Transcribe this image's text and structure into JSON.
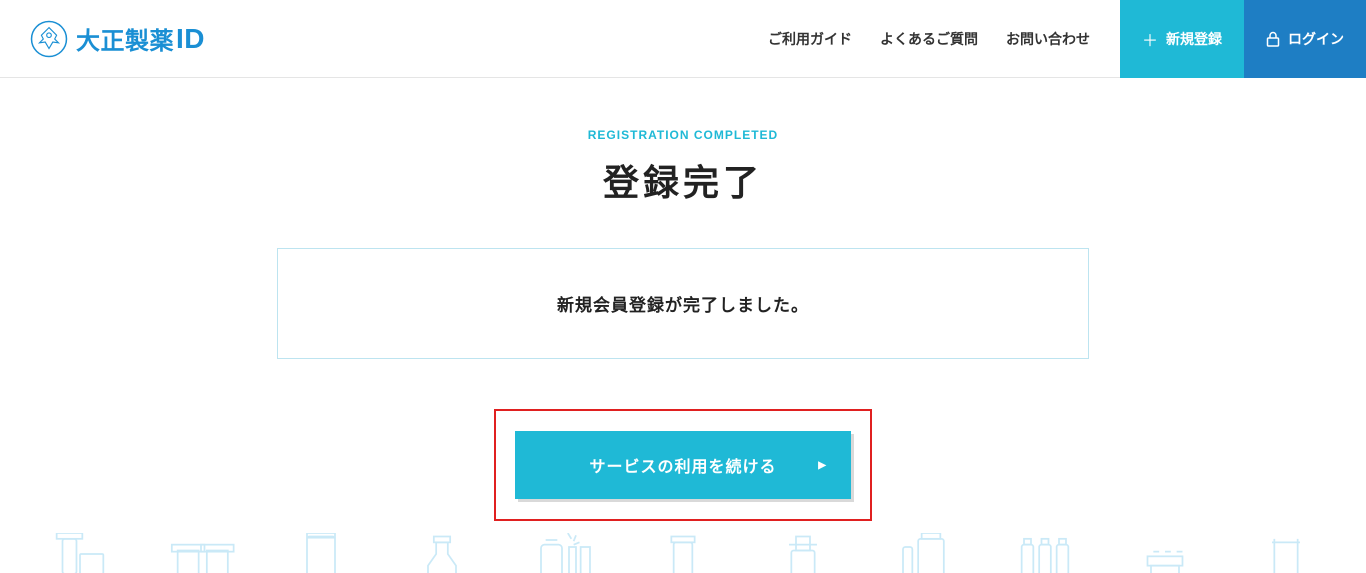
{
  "header": {
    "logo_text_jp": "大正製薬",
    "logo_text_id": "ID",
    "nav": {
      "guide": "ご利用ガイド",
      "faq": "よくあるご質問",
      "contact": "お問い合わせ"
    },
    "register_label": "新規登録",
    "login_label": "ログイン"
  },
  "main": {
    "subtitle_en": "REGISTRATION COMPLETED",
    "title_jp": "登録完了",
    "message": "新規会員登録が完了しました。",
    "continue_label": "サービスの利用を続ける"
  },
  "colors": {
    "primary_cyan": "#1fb9d6",
    "primary_blue": "#1e7ec4",
    "highlight_red": "#e02020",
    "box_border": "#bde4f0"
  }
}
